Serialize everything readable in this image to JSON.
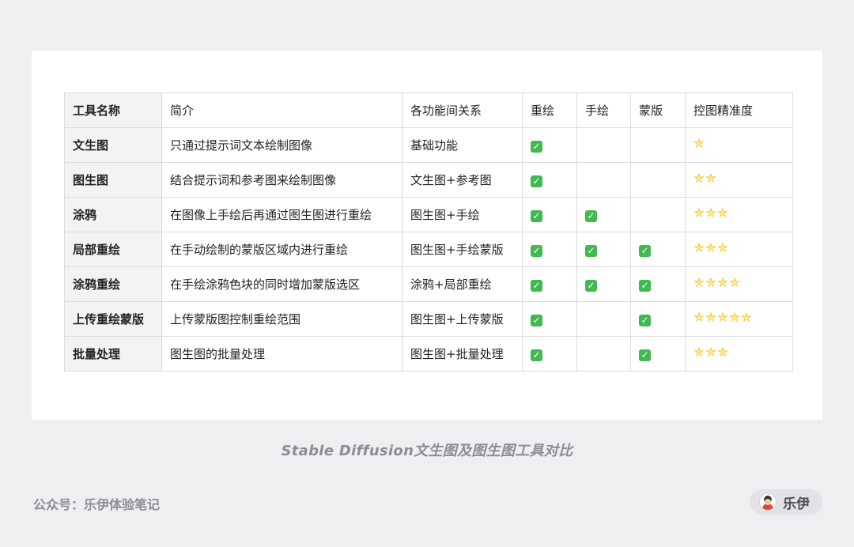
{
  "table": {
    "headers": [
      "工具名称",
      "简介",
      "各功能间关系",
      "重绘",
      "手绘",
      "蒙版",
      "控图精准度"
    ],
    "rows": [
      {
        "name": "文生图",
        "desc": "只通过提示词文本绘制图像",
        "relation": "基础功能",
        "redraw": true,
        "hand": false,
        "mask": false,
        "precision": 1
      },
      {
        "name": "图生图",
        "desc": "结合提示词和参考图来绘制图像",
        "relation": "文生图+参考图",
        "redraw": true,
        "hand": false,
        "mask": false,
        "precision": 2
      },
      {
        "name": "涂鸦",
        "desc": "在图像上手绘后再通过图生图进行重绘",
        "relation": "图生图+手绘",
        "redraw": true,
        "hand": true,
        "mask": false,
        "precision": 3
      },
      {
        "name": "局部重绘",
        "desc": "在手动绘制的蒙版区域内进行重绘",
        "relation": "图生图+手绘蒙版",
        "redraw": true,
        "hand": true,
        "mask": true,
        "precision": 3
      },
      {
        "name": "涂鸦重绘",
        "desc": "在手绘涂鸦色块的同时增加蒙版选区",
        "relation": "涂鸦+局部重绘",
        "redraw": true,
        "hand": true,
        "mask": true,
        "precision": 4
      },
      {
        "name": "上传重绘蒙版",
        "desc": "上传蒙版图控制重绘范围",
        "relation": "图生图+上传蒙版",
        "redraw": true,
        "hand": false,
        "mask": true,
        "precision": 5
      },
      {
        "name": "批量处理",
        "desc": "图生图的批量处理",
        "relation": "图生图+批量处理",
        "redraw": true,
        "hand": false,
        "mask": true,
        "precision": 3
      }
    ]
  },
  "icons": {
    "check": "check-box-icon",
    "star": "star-icon"
  },
  "colors": {
    "check": "#3fb950",
    "star": "#f5c73a"
  },
  "caption": "Stable Diffusion文生图及图生图工具对比",
  "footer": {
    "account": "公众号：乐伊体验笔记",
    "author": "乐伊"
  }
}
